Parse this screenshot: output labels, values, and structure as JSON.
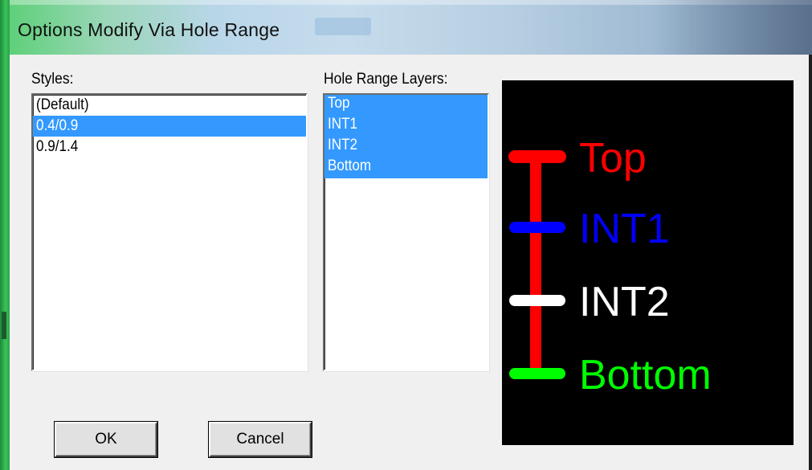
{
  "window": {
    "title": "Options Modify Via Hole Range"
  },
  "styles": {
    "label": "Styles:",
    "items": [
      "(Default)",
      "0.4/0.9",
      "0.9/1.4"
    ],
    "selected_index": 1
  },
  "layers": {
    "label": "Hole Range Layers:",
    "items": [
      "Top",
      "INT1",
      "INT2",
      "Bottom"
    ],
    "all_selected": true
  },
  "preview": {
    "layers": [
      {
        "label": "Top",
        "color": "#ff0000"
      },
      {
        "label": "INT1",
        "color": "#0000ff"
      },
      {
        "label": "INT2",
        "color": "#ffffff"
      },
      {
        "label": "Bottom",
        "color": "#00ff00"
      }
    ],
    "barrel_color": "#ff0000"
  },
  "buttons": {
    "ok": "OK",
    "cancel": "Cancel"
  },
  "colors": {
    "selection": "#3399ff",
    "face": "#f0f0f0"
  }
}
